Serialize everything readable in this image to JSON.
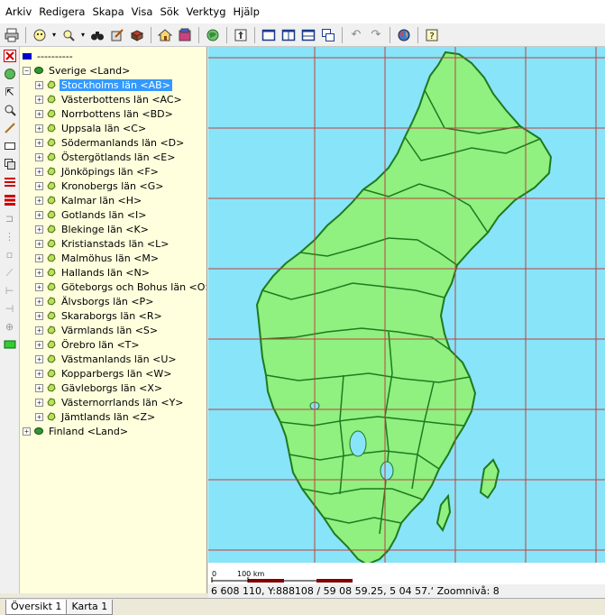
{
  "menu": [
    "Arkiv",
    "Redigera",
    "Skapa",
    "Visa",
    "Sök",
    "Verktyg",
    "Hjälp"
  ],
  "tree": {
    "root_label": "----------",
    "sweden_label": "Sverige <Land>",
    "counties": [
      "Stockholms län <AB>",
      "Västerbottens län <AC>",
      "Norrbottens län <BD>",
      "Uppsala län <C>",
      "Södermanlands län <D>",
      "Östergötlands län <E>",
      "Jönköpings län <F>",
      "Kronobergs län <G>",
      "Kalmar län <H>",
      "Gotlands län <I>",
      "Blekinge län <K>",
      "Kristianstads län <L>",
      "Malmöhus län <M>",
      "Hallands län <N>",
      "Göteborgs och Bohus län <O>",
      "Älvsborgs län <P>",
      "Skaraborgs län <R>",
      "Värmlands län <S>",
      "Örebro län <T>",
      "Västmanlands län <U>",
      "Kopparbergs län <W>",
      "Gävleborgs län <X>",
      "Västernorrlands län <Y>",
      "Jämtlands län <Z>"
    ],
    "finland_label": "Finland <Land>",
    "selected_county": "Stockholms län <AB>"
  },
  "map": {
    "scale_start": "0",
    "scale_label": "100 km",
    "water_color": "#88e4f8",
    "land_color": "#90f080",
    "border_color": "#1e7a1e",
    "grid_color": "#c04040"
  },
  "status": {
    "text": "6 608 110, Y:888108 / 59 08 59.25, 5 04 57.‘ Zoomnivå: 8"
  },
  "tabs": [
    "Översikt 1",
    "Karta 1"
  ],
  "icons": {
    "print": "printer-icon",
    "globe": "globe-icon",
    "search": "binoculars-icon",
    "home": "home-icon",
    "undo": "undo-icon",
    "redo": "redo-icon",
    "help": "help-icon"
  }
}
